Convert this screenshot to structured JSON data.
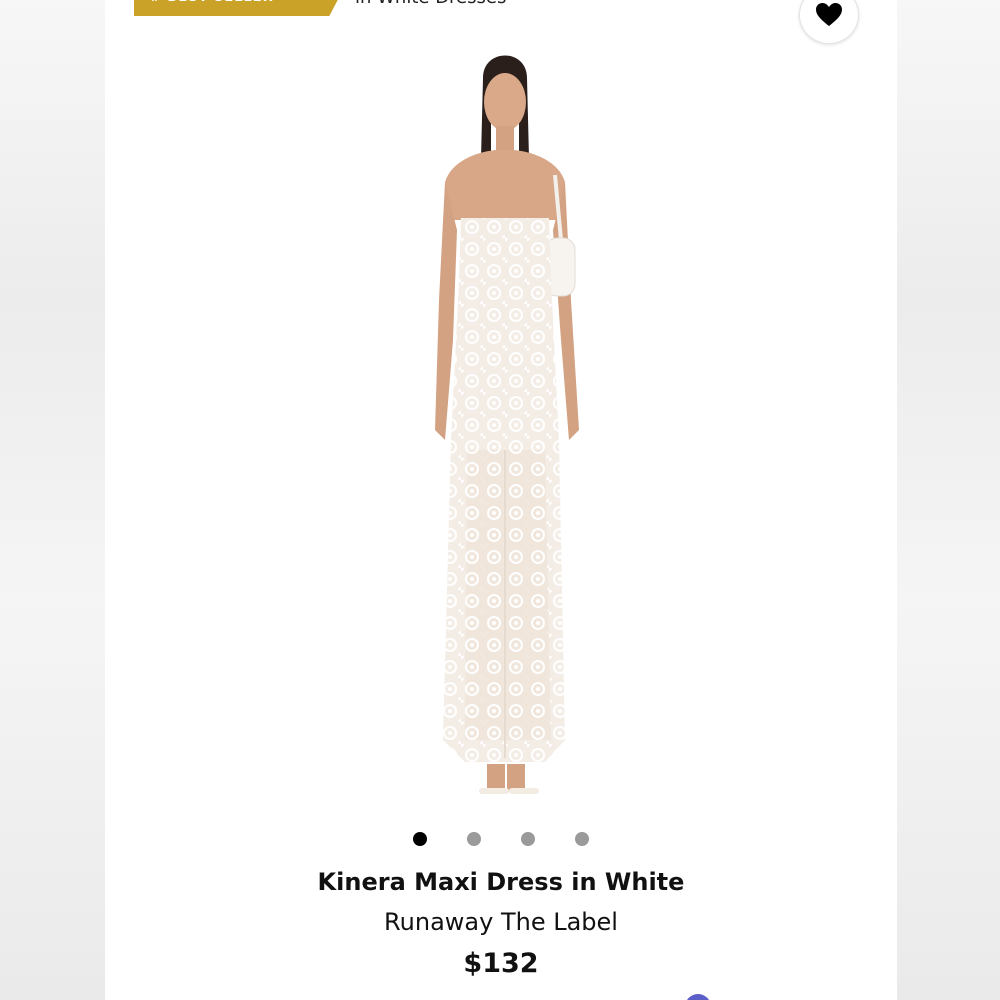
{
  "header": {
    "badge_label": "# BEST SELLER",
    "category_label": "in White Dresses"
  },
  "wishlist": {
    "icon": "heart-icon"
  },
  "carousel": {
    "total_images": 4,
    "active_index": 0
  },
  "product": {
    "title": "Kinera Maxi Dress in White",
    "brand": "Runaway The Label",
    "price": "$132"
  },
  "colors": {
    "badge": "#c9a227",
    "dot_active": "#000000",
    "dot_inactive": "#9a9a9a"
  }
}
